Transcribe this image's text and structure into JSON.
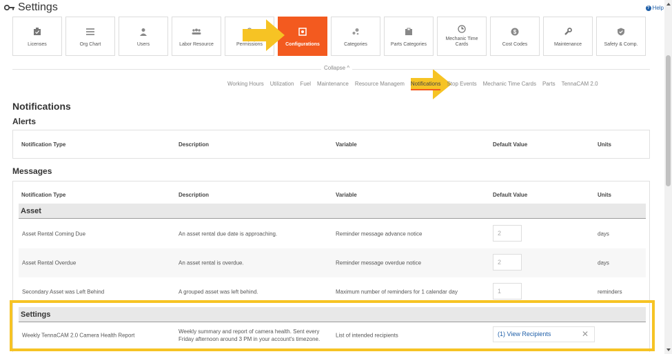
{
  "header": {
    "title": "Settings",
    "help_label": "Help",
    "key_icon": "key-icon"
  },
  "tiles": [
    {
      "label": "Licenses",
      "icon": "license-icon"
    },
    {
      "label": "Org Chart",
      "icon": "org-chart-icon"
    },
    {
      "label": "Users",
      "icon": "user-icon"
    },
    {
      "label": "Labor Resource",
      "icon": "people-icon"
    },
    {
      "label": "Permissions",
      "icon": "lock-icon"
    },
    {
      "label": "Configurations",
      "icon": "gear-icon",
      "active": true
    },
    {
      "label": "Categories",
      "icon": "categories-icon"
    },
    {
      "label": "Parts Categories",
      "icon": "parts-icon"
    },
    {
      "label": "Mechanic Time Cards",
      "icon": "clock-icon"
    },
    {
      "label": "Cost Codes",
      "icon": "dollar-icon"
    },
    {
      "label": "Maintenance",
      "icon": "wrench-icon"
    },
    {
      "label": "Safety & Comp.",
      "icon": "shield-icon"
    }
  ],
  "collapse_label": "Collapse ^",
  "subtabs": [
    "Working Hours",
    "Utilization",
    "Fuel",
    "Maintenance",
    "Resource Managem",
    "Notifications",
    "Stop Events",
    "Mechanic Time Cards",
    "Parts",
    "TennaCAM 2.0"
  ],
  "page": {
    "title": "Notifications",
    "alerts_title": "Alerts",
    "messages_title": "Messages"
  },
  "columns": {
    "type": "Notification Type",
    "description": "Description",
    "variable": "Variable",
    "default": "Default Value",
    "units": "Units"
  },
  "groups": {
    "asset": {
      "title": "Asset",
      "rows": [
        {
          "type": "Asset Rental Coming Due",
          "description": "An asset rental due date is approaching.",
          "variable": "Reminder message advance notice",
          "default": "2",
          "units": "days"
        },
        {
          "type": "Asset Rental Overdue",
          "description": "An asset rental is overdue.",
          "variable": "Reminder message overdue notice",
          "default": "2",
          "units": "days"
        },
        {
          "type": "Secondary Asset was Left Behind",
          "description": "A grouped asset was left behind.",
          "variable": "Maximum number of reminders for 1 calendar day",
          "default": "1",
          "units": "reminders"
        }
      ]
    },
    "settings": {
      "title": "Settings",
      "row": {
        "type": "Weekly TennaCAM 2.0 Camera Health Report",
        "description_1": "Weekly summary and report of camera health. Sent every",
        "description_2": "Friday afternoon around 3 PM in your account's timezone.",
        "variable": "List of intended recipients",
        "recipients_label": "(1) View Recipients",
        "clear": "✕"
      }
    }
  },
  "colors": {
    "accent": "#f35a1f",
    "annotation": "#f6c324",
    "link": "#1f5fa8"
  }
}
